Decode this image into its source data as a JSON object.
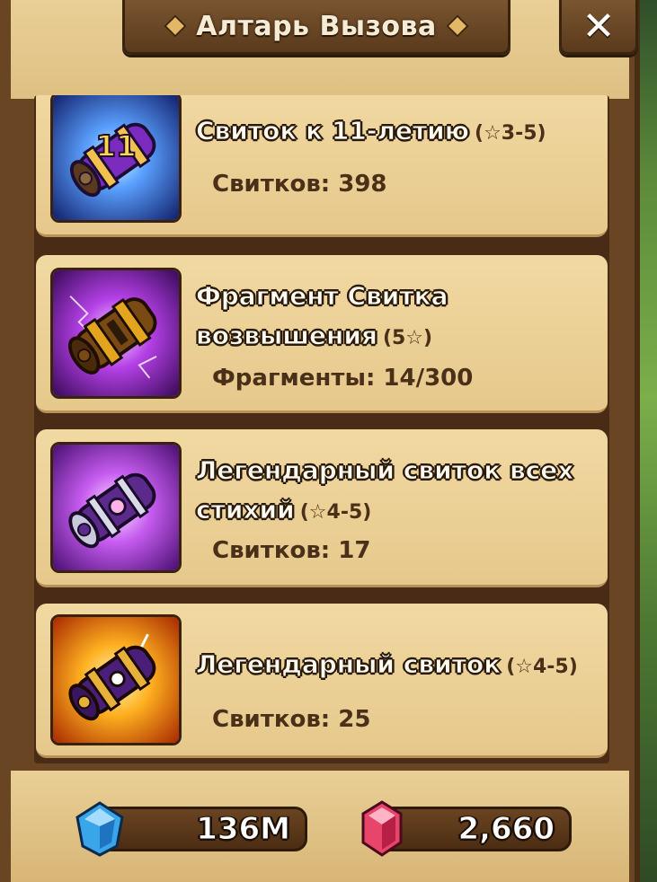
{
  "window": {
    "title": "Алтарь Вызова",
    "close_label": "✕"
  },
  "scrolls": [
    {
      "name": "Свиток к 11-летию",
      "rarity": "(☆3-5)",
      "count_text": "Свитков: 398",
      "icon": "anniversary-11-scroll-icon"
    },
    {
      "name_line1": "Фрагмент Свитка",
      "name_line2": "возвышения",
      "rarity": "(5☆)",
      "count_text": "Фрагменты: 14/300",
      "icon": "transcendence-scroll-fragment-icon"
    },
    {
      "name_line1": "Легендарный свиток всех",
      "name_line2": "стихий",
      "rarity": "(☆4-5)",
      "count_text": "Свитков: 17",
      "icon": "legendary-all-attribute-scroll-icon"
    },
    {
      "name": "Легендарный свиток",
      "rarity": "(☆4-5)",
      "count_text": "Свитков: 25",
      "icon": "legendary-scroll-icon"
    }
  ],
  "currencies": {
    "mana": {
      "value": "136M",
      "icon": "mana-crystal-icon",
      "color": "#3aa6ea"
    },
    "crystals": {
      "value": "2,660",
      "icon": "red-crystal-icon",
      "color": "#e8456b"
    }
  }
}
